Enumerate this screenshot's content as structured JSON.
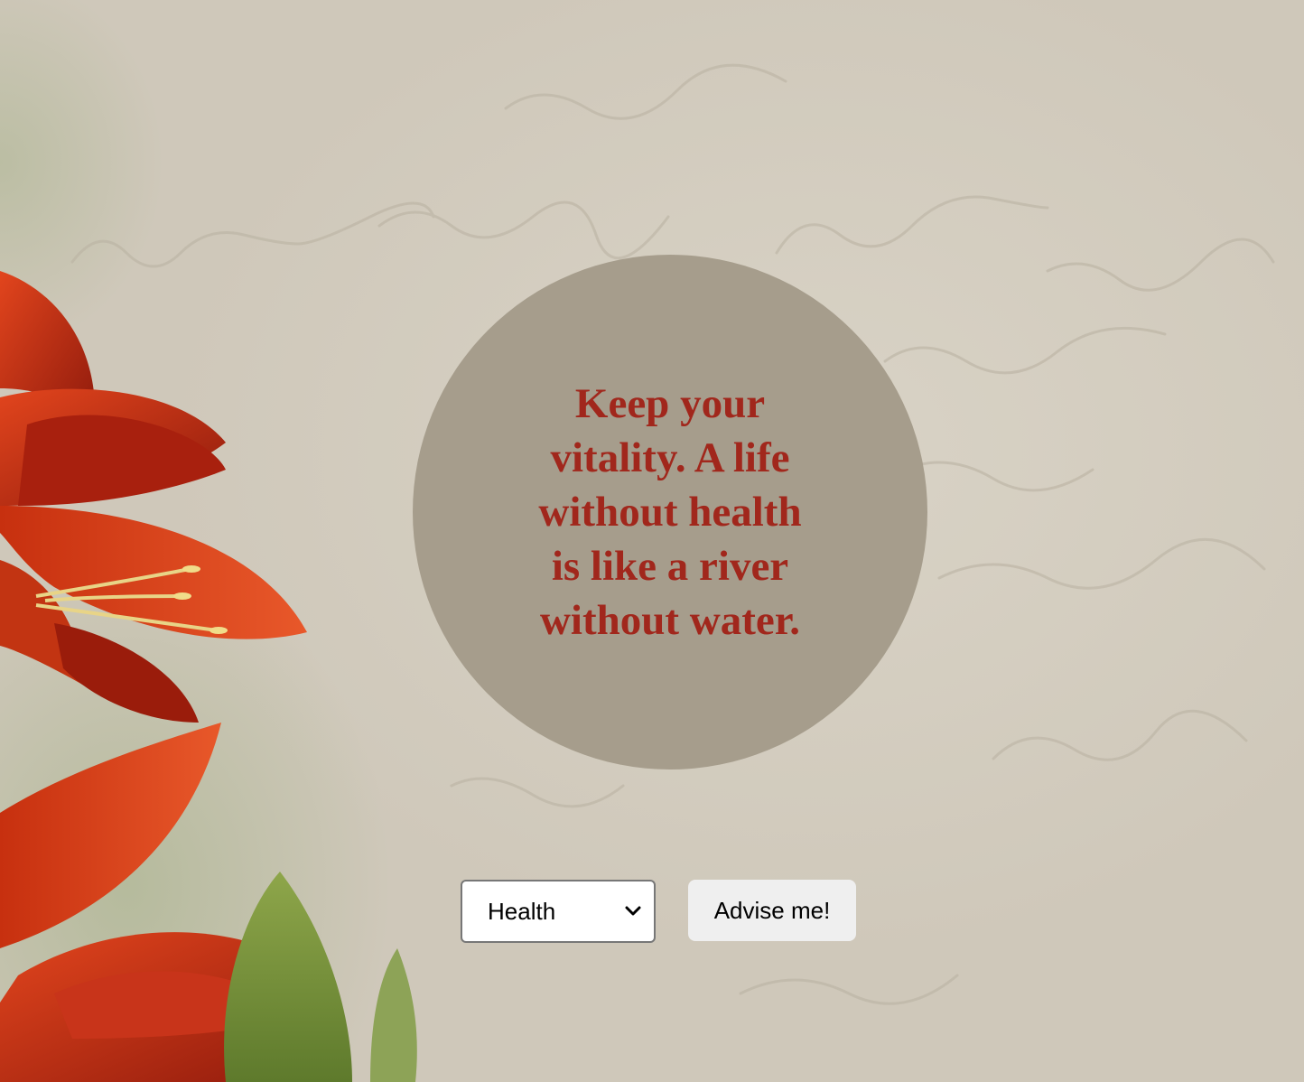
{
  "advice": {
    "text": "Keep your vitality. A life without health is like a river without water."
  },
  "controls": {
    "category_selected": "Health",
    "button_label": "Advise me!"
  },
  "colors": {
    "background": "#d6d0c3",
    "circle": "#a69d8c",
    "advice_text": "#a1271c",
    "button": "#efefef"
  }
}
